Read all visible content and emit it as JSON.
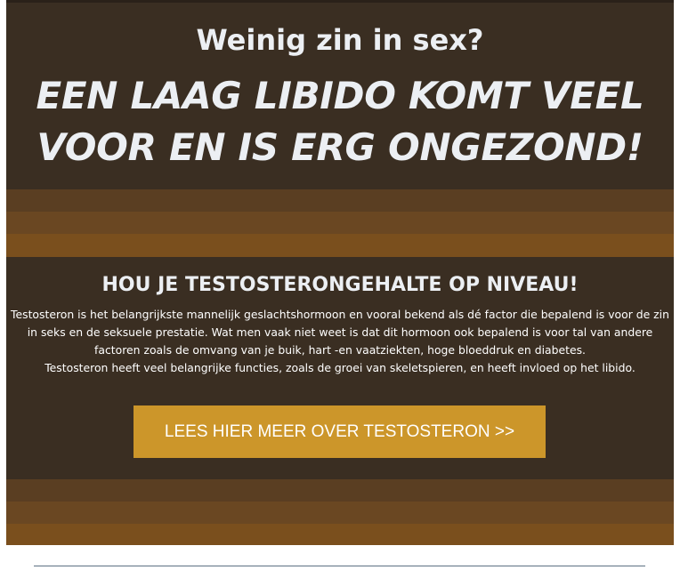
{
  "hero": {
    "subtitle": "Weinig zin in sex?",
    "title_line1": "EEN LAAG LIBIDO KOMT VEEL",
    "title_line2": "VOOR EN IS ERG ONGEZOND!"
  },
  "section": {
    "heading": "HOU JE TESTOSTERONGEHALTE OP NIVEAU!",
    "paragraph1": "Testosteron is het belangrijkste mannelijk geslachtshormoon en vooral bekend als dé factor die bepalend is voor de zin in seks en de seksuele prestatie. Wat men vaak niet weet is dat dit hormoon ook bepalend is voor tal van andere factoren zoals de omvang van je buik, hart -en vaatziekten, hoge bloeddruk en diabetes.",
    "paragraph2": "Testosteron heeft veel belangrijke functies, zoals de groei van skeletspieren, en heeft invloed op het libido."
  },
  "cta": {
    "label": "LEES HIER MEER OVER TESTOSTERON >>"
  },
  "colors": {
    "background": "#3a2e22",
    "stripe_1": "#5a3e22",
    "stripe_2": "#6a4722",
    "stripe_3": "#7a4f1d",
    "button": "#cc962a",
    "text": "#eceff3"
  }
}
